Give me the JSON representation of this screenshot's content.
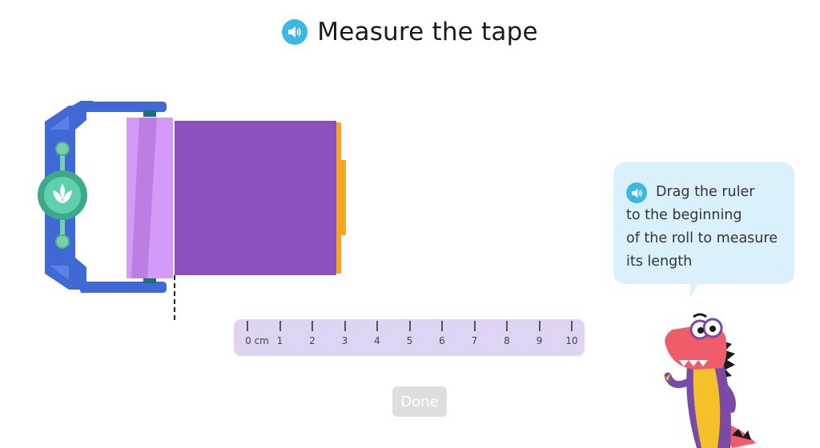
{
  "header": {
    "title": "Measure the tape",
    "audio_icon": "speaker-icon"
  },
  "ruler": {
    "labels": [
      "0 cm",
      "1",
      "2",
      "3",
      "4",
      "5",
      "6",
      "7",
      "8",
      "9",
      "10"
    ]
  },
  "done_button": {
    "label": "Done"
  },
  "hint": {
    "audio_icon": "speaker-icon",
    "lines": [
      "Drag the ruler",
      "to the beginning",
      "of the roll to measure",
      "its length"
    ]
  },
  "colors": {
    "accent": "#3db7e4",
    "dispenser": "#4169d6",
    "tape": "#8b4fbe",
    "ruler": "#e0d4f4",
    "bubble": "#daf0fb",
    "mascot": "#ef5d6b"
  }
}
